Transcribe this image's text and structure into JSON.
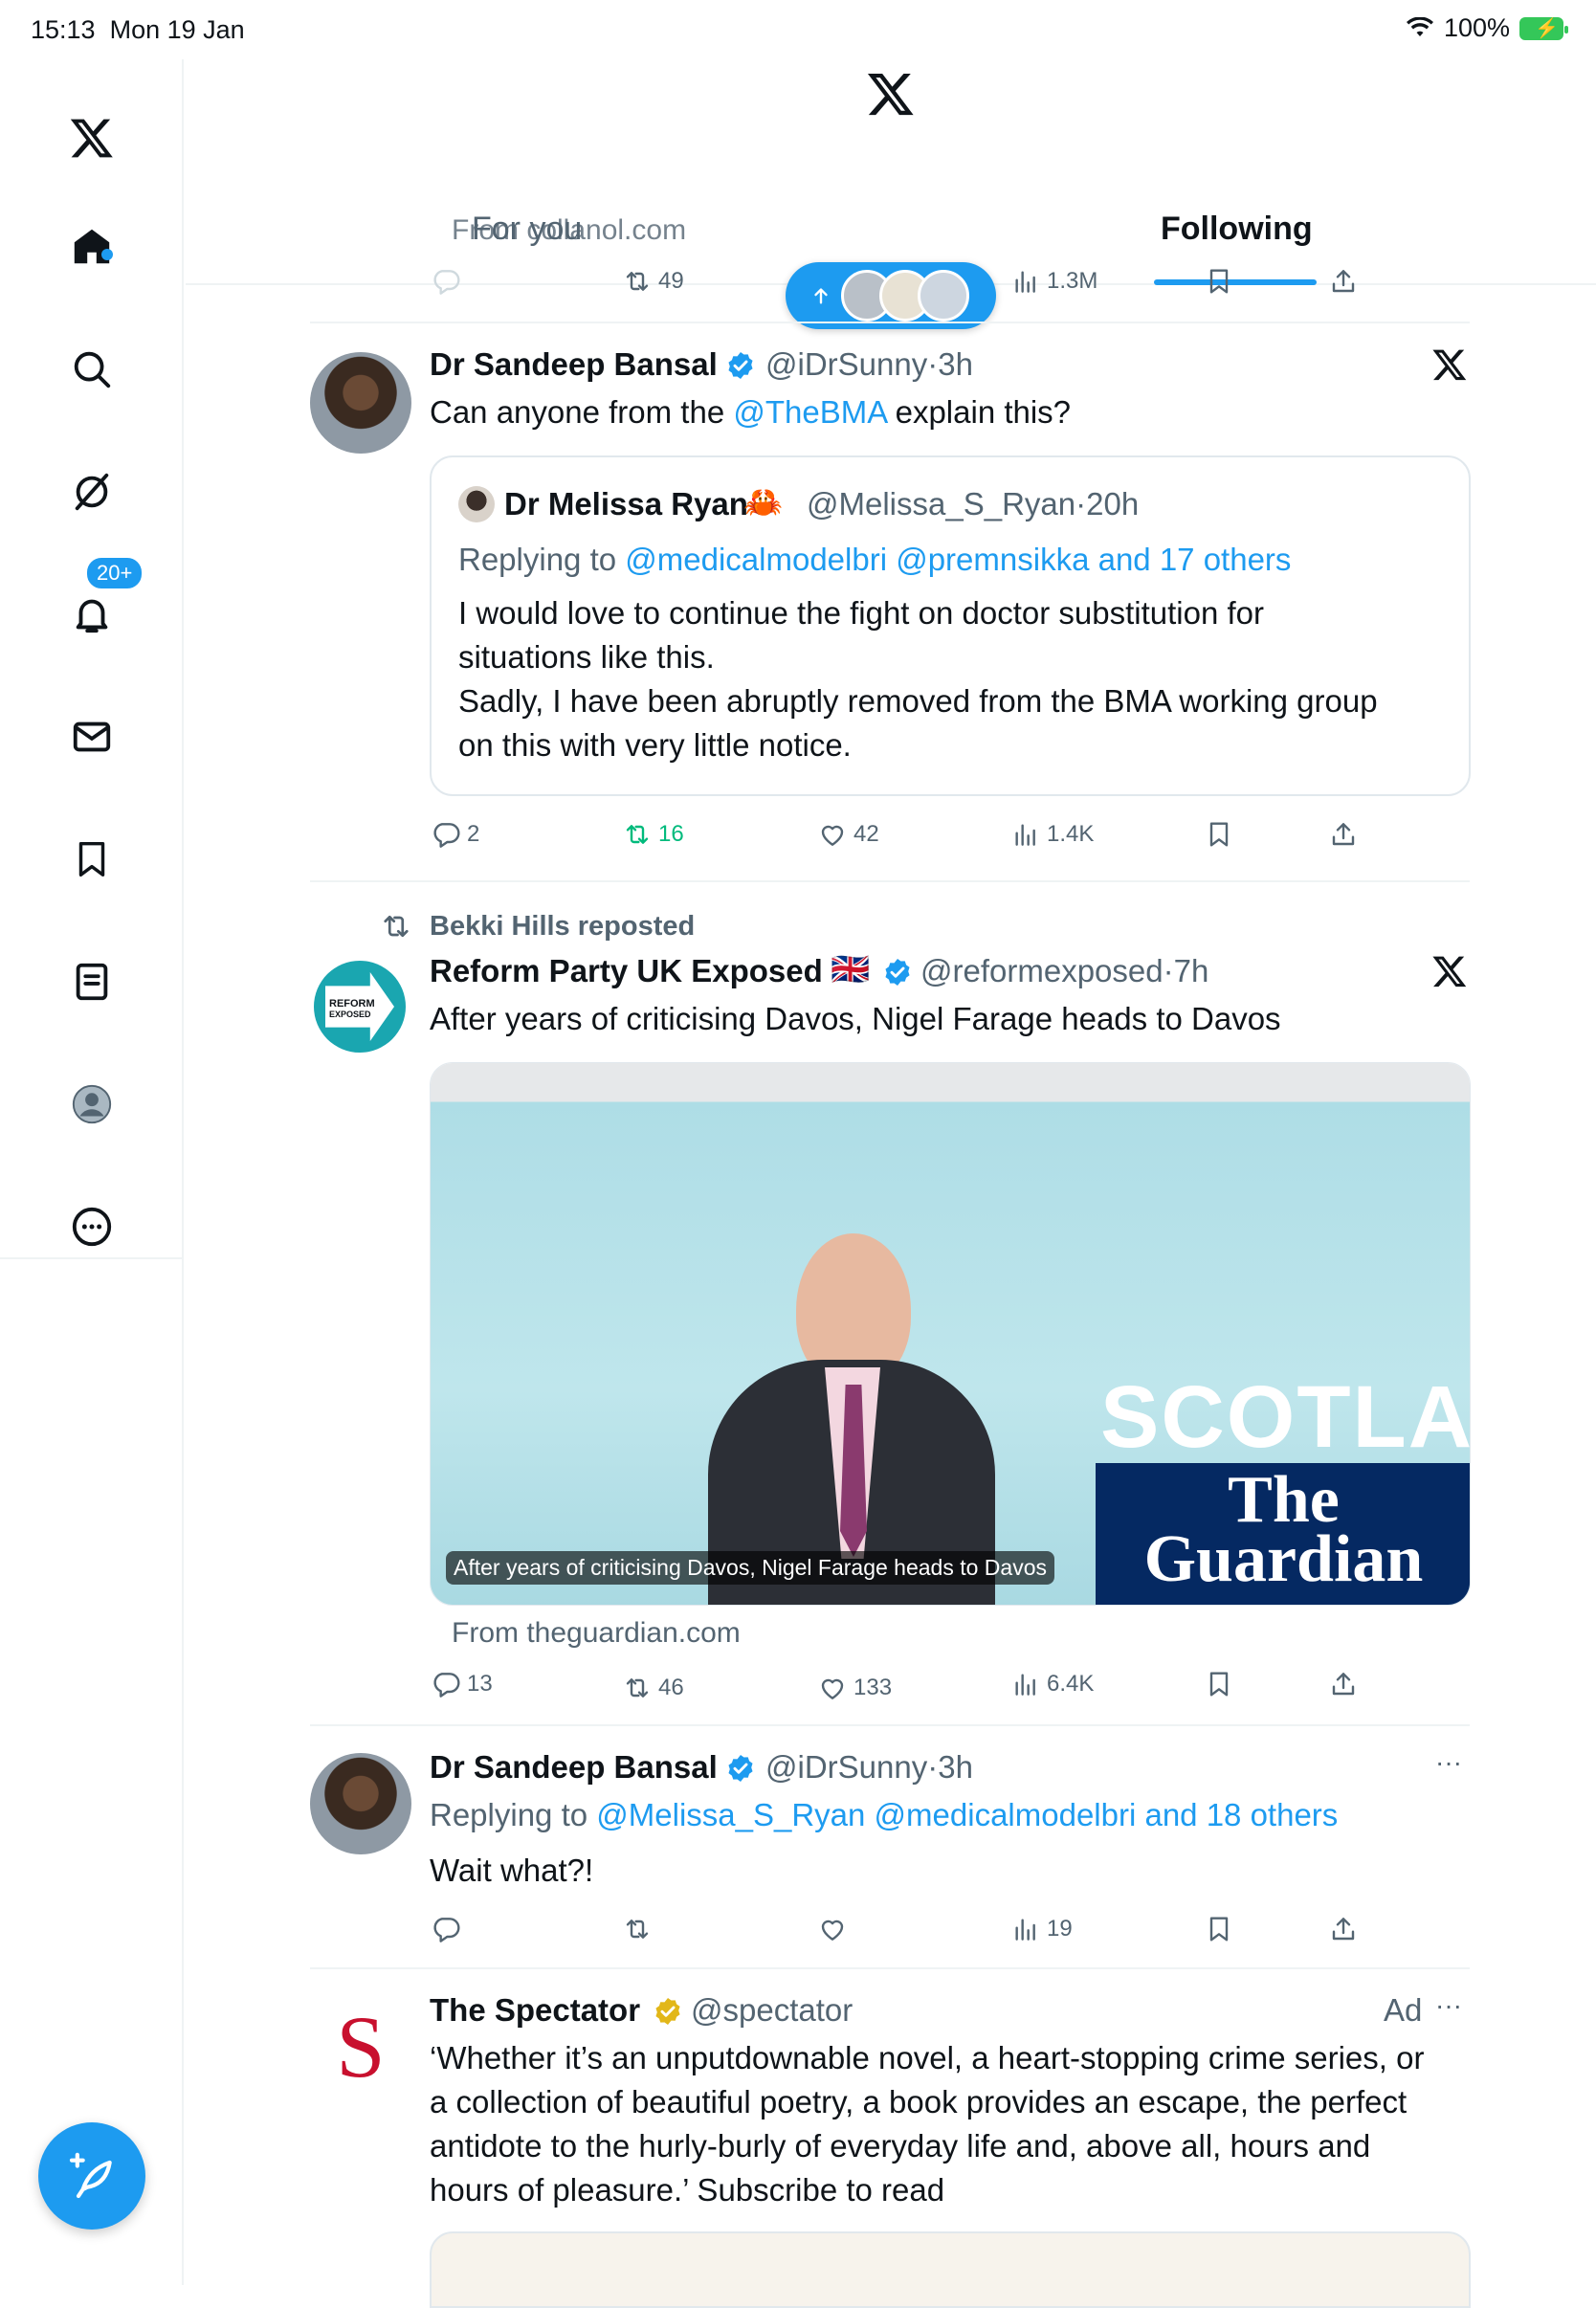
{
  "status": {
    "time": "15:13",
    "date": "Mon 19 Jan",
    "battery": "100%"
  },
  "sidebar": {
    "notifications_badge": "20+",
    "items": [
      "home-icon",
      "search-icon",
      "grok-icon",
      "notifications-icon",
      "messages-icon",
      "bookmarks-icon",
      "lists-icon",
      "profile-icon",
      "more-icon"
    ]
  },
  "tabs": {
    "for_you": "For you",
    "following": "Following"
  },
  "colors": {
    "accent": "#1d9bf0",
    "retweet_active": "#00ba7c"
  },
  "top_partial": {
    "source": "From collanol.com",
    "retweets": "49",
    "views": "1.3M"
  },
  "tweet1": {
    "name": "Dr Sandeep Bansal",
    "handle": "@iDrSunny",
    "time": "3h",
    "text_pre": "Can anyone from the ",
    "mention": "@TheBMA",
    "text_post": " explain this?",
    "quote": {
      "name": "Dr Melissa Ryan",
      "emoji": "🦀",
      "handle": "@Melissa_S_Ryan",
      "time": "20h",
      "replying_label": "Replying to ",
      "replying_to": "@medicalmodelbri @premnsikka and 17 others",
      "line1": "I would love to continue the fight on doctor substitution for",
      "line2": "situations like this.",
      "line3": "Sadly, I have been abruptly removed from the BMA working group",
      "line4": "on this with very little notice."
    },
    "replies": "2",
    "retweets": "16",
    "likes": "42",
    "views": "1.4K"
  },
  "tweet2": {
    "repost_label": "Bekki Hills reposted",
    "name": "Reform Party UK Exposed",
    "flag": "🇬🇧",
    "handle": "@reformexposed",
    "time": "7h",
    "text": "After years of criticising Davos, Nigel Farage heads to Davos",
    "media_caption": "After years of criticising Davos, Nigel Farage heads to Davos",
    "media_banner": "SCOTLAN",
    "media_brand_1": "The",
    "media_brand_2": "Guardian",
    "source": "From theguardian.com",
    "avatar_text_1": "REFORM",
    "avatar_text_2": "EXPOSED",
    "replies": "13",
    "retweets": "46",
    "likes": "133",
    "views": "6.4K"
  },
  "tweet3": {
    "name": "Dr Sandeep Bansal",
    "handle": "@iDrSunny",
    "time": "3h",
    "replying_label": "Replying to ",
    "replying_to": "@Melissa_S_Ryan @medicalmodelbri and 18 others",
    "text": "Wait what?!",
    "views": "19"
  },
  "tweet4": {
    "name": "The Spectator",
    "handle": "@spectator",
    "ad_label": "Ad",
    "avatar_letter": "S",
    "line1": "‘Whether it’s an unputdownable novel, a heart-stopping crime series, or",
    "line2": "a collection of beautiful poetry, a book provides an escape, the perfect",
    "line3": "antidote to the hurly-burly of everyday life and, above all, hours and",
    "line4": "hours of pleasure.’ Subscribe to read"
  },
  "dot_separator": "·",
  "more_glyph": "···"
}
